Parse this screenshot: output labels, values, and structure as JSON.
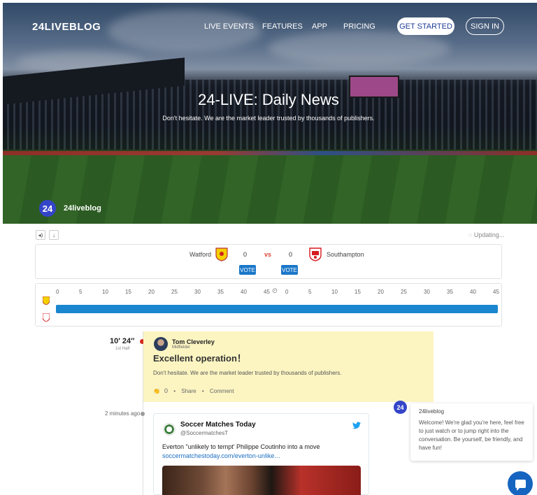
{
  "header": {
    "logo": "24LIVEBLOG",
    "nav": [
      "LIVE EVENTS",
      "FEATURES",
      "APP",
      "PRICING"
    ],
    "get_started": "GET STARTED",
    "sign_in": "SIGN IN"
  },
  "hero": {
    "title": "24-LIVE: Daily News",
    "subtitle": "Don't hesitate. We are the market leader trusted by thousands of publishers.",
    "badge": "24",
    "brand": "24liveblog"
  },
  "toolbar": {
    "sound_icon": "speaker-icon",
    "sort_icon": "arrow-down-icon",
    "status": "Updating..."
  },
  "match": {
    "home": {
      "name": "Watford",
      "score": "0",
      "vote": "VOTE",
      "color": "#f5d000"
    },
    "away": {
      "name": "Southampton",
      "score": "0",
      "vote": "VOTE",
      "color": "#d71920"
    },
    "vs": "vs"
  },
  "timeline": {
    "first_half_ticks": [
      "0",
      "5",
      "10",
      "15",
      "20",
      "25",
      "30",
      "35",
      "40",
      "45"
    ],
    "second_half_ticks": [
      "0",
      "5",
      "10",
      "15",
      "20",
      "25",
      "30",
      "35",
      "40",
      "45"
    ],
    "bar_color": "#1a86cf"
  },
  "feed": {
    "post": {
      "time": "10′ 24″",
      "period": "1st Half",
      "author": "Tom Cleverley",
      "role": "Midfielder",
      "title": "Excellent operation！",
      "body": "Don't hesitate. We are the market leader trusted by thousands of publishers.",
      "likes": "0",
      "share": "Share",
      "comment": "Comment"
    },
    "tweet": {
      "ago": "2 minutes ago",
      "name": "Soccer Matches Today",
      "handle": "@SoccermatchesT",
      "text": "Everton \"unlikely to tempt' Philippe Coutinho into a move",
      "link": "soccermatchestoday.com/everton-unlike…"
    }
  },
  "chat": {
    "badge": "24",
    "from": "24liveblog",
    "message": "Welcome! We're glad you're here, feel free to just watch or to jump right into the conversation. Be yourself, be friendly, and have fun!"
  }
}
